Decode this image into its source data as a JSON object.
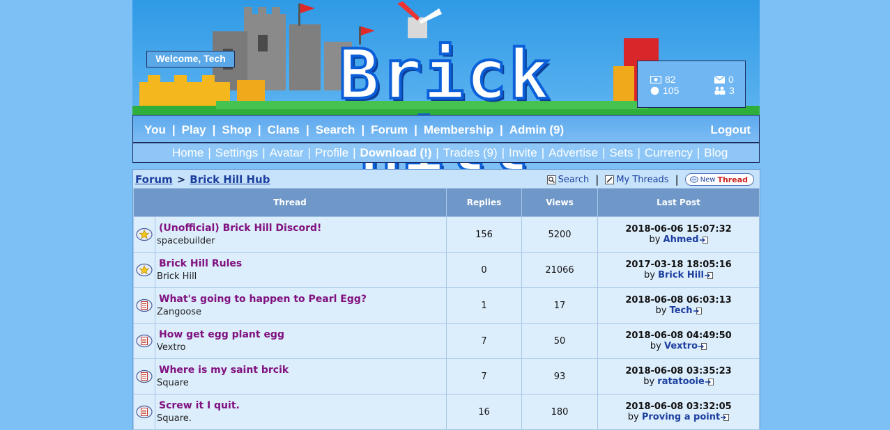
{
  "header": {
    "welcome": "Welcome, Tech",
    "logo": "Brick Hill",
    "stats": {
      "bucks": "82",
      "bits": "105",
      "messages": "0",
      "friend_requests": "3"
    }
  },
  "nav_primary": {
    "items": [
      "You",
      "Play",
      "Shop",
      "Clans",
      "Search",
      "Forum",
      "Membership",
      "Admin (9)"
    ],
    "logout": "Logout"
  },
  "nav_secondary": {
    "items": [
      "Home",
      "Settings",
      "Avatar",
      "Profile",
      "Download (!)",
      "Trades (9)",
      "Invite",
      "Advertise",
      "Sets",
      "Currency",
      "Blog"
    ]
  },
  "breadcrumb": {
    "root": "Forum",
    "separator": ">",
    "current": "Brick Hill Hub"
  },
  "toolbar": {
    "search": "Search",
    "my_threads": "My Threads",
    "new_thread_prefix": "New",
    "new_thread_suffix": "Thread"
  },
  "table": {
    "headers": {
      "thread": "Thread",
      "replies": "Replies",
      "views": "Views",
      "last_post": "Last Post"
    },
    "rows": [
      {
        "icon": "star",
        "title": "(Unofficial) Brick Hill Discord!",
        "author": "spacebuilder",
        "replies": "156",
        "views": "5200",
        "last_date": "2018-06-06 15:07:32",
        "by": "by",
        "last_user": "Ahmed"
      },
      {
        "icon": "star",
        "title": "Brick Hill Rules",
        "author": "Brick Hill",
        "replies": "0",
        "views": "21066",
        "last_date": "2017-03-18 18:05:16",
        "by": "by",
        "last_user": "Brick Hill"
      },
      {
        "icon": "doc",
        "title": "What's going to happen to Pearl Egg?",
        "author": "Zangoose",
        "replies": "1",
        "views": "17",
        "last_date": "2018-06-08 06:03:13",
        "by": "by",
        "last_user": "Tech"
      },
      {
        "icon": "doc",
        "title": "How get egg plant egg",
        "author": "Vextro",
        "replies": "7",
        "views": "50",
        "last_date": "2018-06-08 04:49:50",
        "by": "by",
        "last_user": "Vextro"
      },
      {
        "icon": "doc",
        "title": "Where is my saint brcik",
        "author": "Square",
        "replies": "7",
        "views": "93",
        "last_date": "2018-06-08 03:35:23",
        "by": "by",
        "last_user": "ratatooie"
      },
      {
        "icon": "doc",
        "title": "Screw it I quit.",
        "author": "Square.",
        "replies": "16",
        "views": "180",
        "last_date": "2018-06-08 03:32:05",
        "by": "by",
        "last_user": "Proving a point"
      }
    ]
  },
  "colors": {
    "page_bg": "#7dc0f5",
    "thread_title": "#80117f",
    "link": "#1c3f9e",
    "header_row": "#6f98c9",
    "row_bg": "#dcedfc"
  }
}
